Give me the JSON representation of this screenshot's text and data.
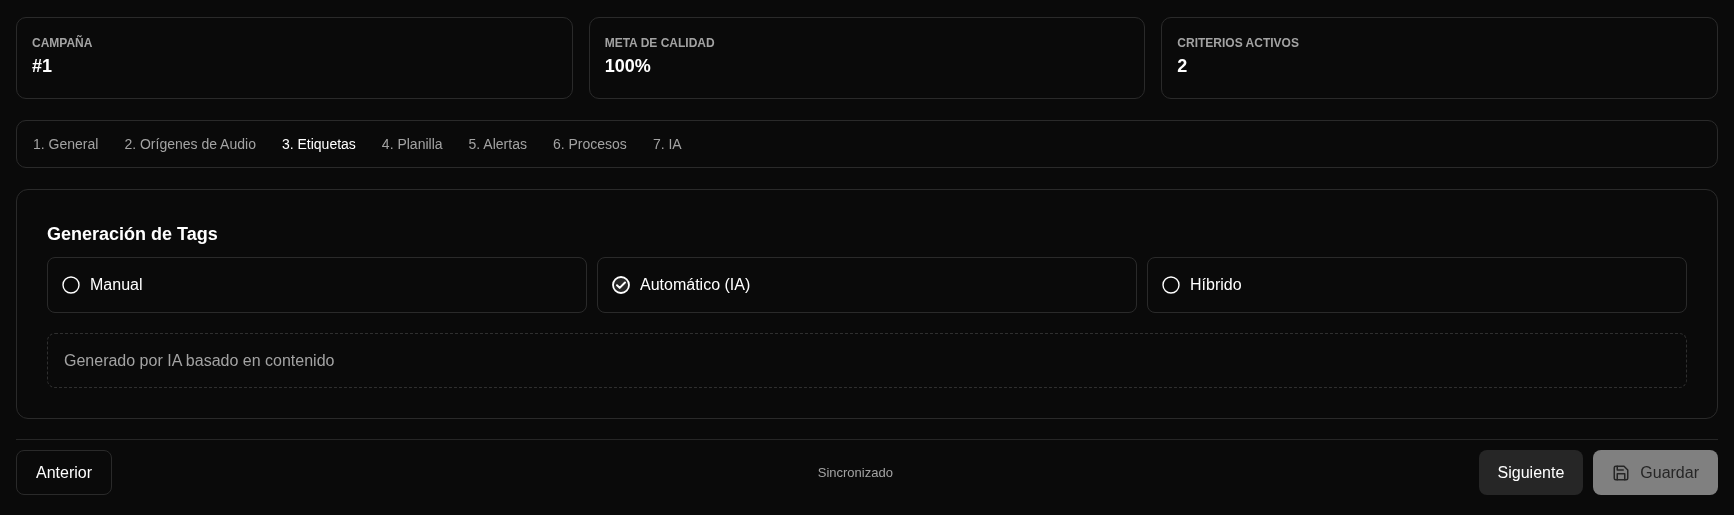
{
  "stats": [
    {
      "label": "CAMPAÑA",
      "value": "#1"
    },
    {
      "label": "META DE CALIDAD",
      "value": "100%"
    },
    {
      "label": "CRITERIOS ACTIVOS",
      "value": "2"
    }
  ],
  "tabs": [
    {
      "label": "1. General",
      "selected": false
    },
    {
      "label": "2. Orígenes de Audio",
      "selected": false
    },
    {
      "label": "3. Etiquetas",
      "selected": true
    },
    {
      "label": "4. Planilla",
      "selected": false
    },
    {
      "label": "5. Alertas",
      "selected": false
    },
    {
      "label": "6. Procesos",
      "selected": false
    },
    {
      "label": "7. IA",
      "selected": false
    }
  ],
  "panel": {
    "title": "Generación de Tags",
    "options": [
      {
        "label": "Manual",
        "selected": false
      },
      {
        "label": "Automático (IA)",
        "selected": true
      },
      {
        "label": "Híbrido",
        "selected": false
      }
    ],
    "description": "Generado por IA basado en contenido"
  },
  "footer": {
    "back": "Anterior",
    "status": "Sincronizado",
    "next": "Siguiente",
    "save": {
      "label": "Guardar",
      "disabled": true
    }
  }
}
